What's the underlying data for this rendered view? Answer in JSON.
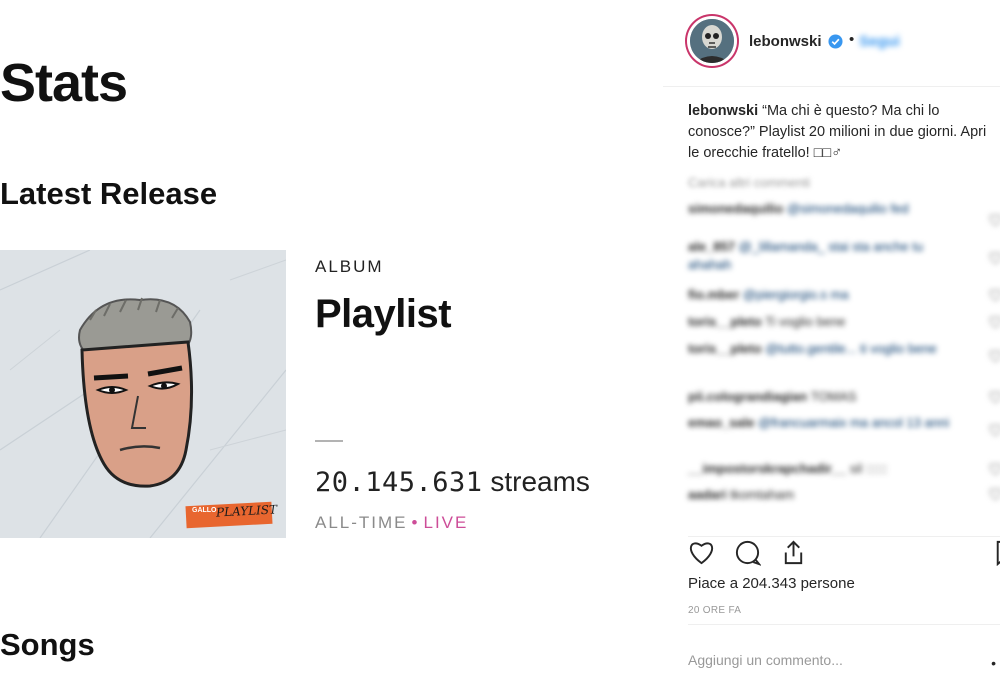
{
  "stats": {
    "title": "Stats",
    "latest_release_heading": "Latest Release",
    "songs_heading": "Songs",
    "release": {
      "type": "ALBUM",
      "name": "Playlist",
      "streams_number": "20.145.631",
      "streams_unit": "streams",
      "period_label": "ALL-TIME",
      "period_separator": "•",
      "live_label": "LIVE",
      "cover": {
        "artist": "GALLO",
        "title": "PLAYLIST"
      }
    }
  },
  "instagram": {
    "username": "lebonwski",
    "header_separator": "•",
    "follow_label": "Segui",
    "caption": {
      "username": "lebonwski",
      "text": "“Ma chi è questo? Ma chi lo conosce?” Playlist 20 milioni in due giorni. Apri le orecchie fratello! □□♂"
    },
    "load_more": "Carica altri commenti",
    "comments": [
      {
        "user": "simonedaquilio",
        "text": "@simonedaquilio fed"
      },
      {
        "user": "ale_857",
        "text": "@_lillamanda_ stai sta anche tu ahahah"
      },
      {
        "user": "fio.mber",
        "text": "@piergiorgio.s ma"
      },
      {
        "user": "toris__pleto",
        "text": "Ti voglio bene"
      },
      {
        "user": "toris__pleto",
        "text": "@tutto.gentile... ti voglio bene"
      },
      {
        "user": "pii.colograndiagian",
        "text": "TOMAS"
      },
      {
        "user": "emao_sale",
        "text": "@francuarmaix ma ancol 13 anni"
      },
      {
        "user": "__impostorskrapchadir__",
        "text": "sil ::::::"
      },
      {
        "user": "aadari",
        "text": "tkomtaham"
      }
    ],
    "likes_text": "Piace a 204.343 persone",
    "time_ago": "20 ORE FA",
    "add_comment_placeholder": "Aggiungi un commento..."
  },
  "colors": {
    "live_accent": "#cd4d98",
    "instagram_link": "#3897f0",
    "verified_blue": "#3897f0"
  },
  "icons": [
    "verified-badge-icon",
    "heart-icon",
    "comment-icon",
    "share-icon",
    "bookmark-icon",
    "more-dots-icon"
  ]
}
